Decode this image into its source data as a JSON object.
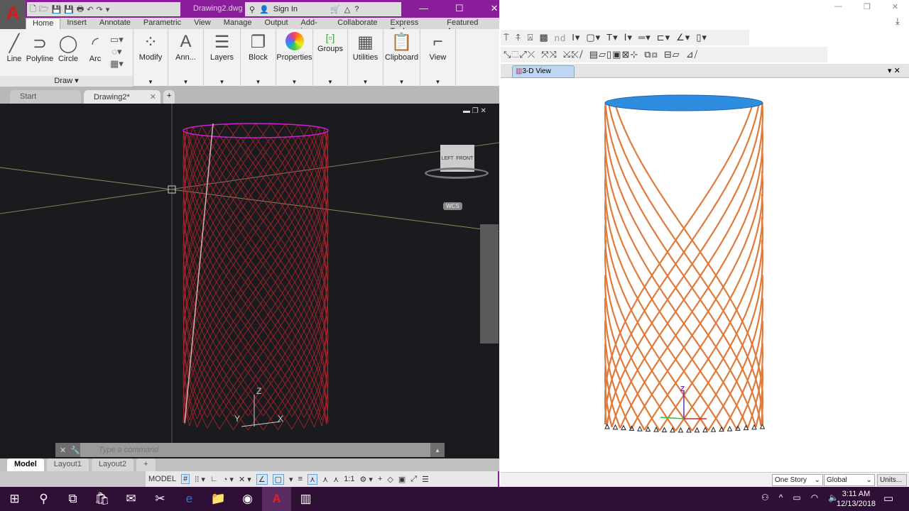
{
  "acad": {
    "title": "Drawing2.dwg",
    "sign_in": "Sign In",
    "logo": "A",
    "ribbon_tabs": [
      "Home",
      "Insert",
      "Annotate",
      "Parametric",
      "View",
      "Manage",
      "Output",
      "Add-ins",
      "Collaborate",
      "Express Tools",
      "Featured Apps"
    ],
    "draw_tools": [
      "Line",
      "Polyline",
      "Circle",
      "Arc"
    ],
    "draw_panel": "Draw",
    "panels": [
      "Modify",
      "Ann...",
      "Layers",
      "Block",
      "Properties",
      "Groups",
      "Utilities",
      "Clipboard",
      "View"
    ],
    "doc_tabs": [
      "Start",
      "Drawing2*"
    ],
    "viewcube": {
      "left": "LEFT",
      "front": "FRONT",
      "wcs": "WCS"
    },
    "axes": {
      "x": "X",
      "y": "Y",
      "z": "Z"
    },
    "command_placeholder": "Type a command",
    "layout_tabs": [
      "Model",
      "Layout1",
      "Layout2"
    ],
    "status": {
      "model": "MODEL",
      "scale": "1:1"
    },
    "colors": {
      "title_bar": "#8a1d9a",
      "wireframe": "#b0242c",
      "top": "#d020d0"
    }
  },
  "etabs": {
    "toolbar_text": "nd",
    "view_tab": "3-D View",
    "axis_z": "Z",
    "story_select": "One Story",
    "coord_select": "Global",
    "units_button": "Units...",
    "colors": {
      "members": "#e07a3a",
      "slab": "#2f8de0"
    }
  },
  "taskbar": {
    "time": "3:11 AM",
    "date": "12/13/2018"
  }
}
